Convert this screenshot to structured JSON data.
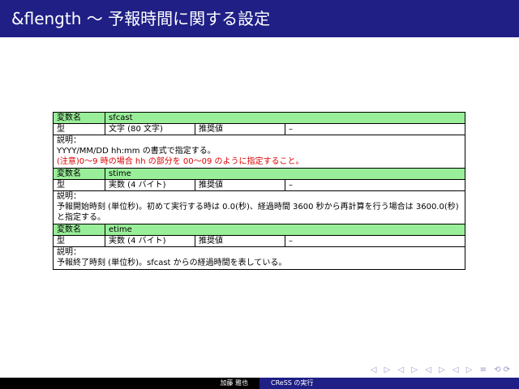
{
  "slide": {
    "title": "&flength 〜 予報時間に関する設定"
  },
  "labels": {
    "var_name": "変数名",
    "type": "型",
    "recommended": "推奨値",
    "description": "説明："
  },
  "variables": [
    {
      "name": "sfcast",
      "type": "文字 (80 文字)",
      "recommended": "–",
      "desc_line1": "YYYY/MM/DD hh:mm の書式で指定する。",
      "desc_line2": "(注意)0〜9 時の場合 hh の部分を 00〜09 のように指定すること。"
    },
    {
      "name": "stime",
      "type": "実数 (4 バイト)",
      "recommended": "–",
      "desc_line1": "予報開始時刻 (単位秒)。初めて実行する時は 0.0(秒)、経過時間 3600 秒から再計算を行う場合は 3600.0(秒) と指定する。"
    },
    {
      "name": "etime",
      "type": "実数 (4 バイト)",
      "recommended": "–",
      "desc_line1": "予報終了時刻 (単位秒)。sfcast からの経過時間を表している。"
    }
  ],
  "navigation": {
    "symbols": "◁ ▷ ◁ ▷ ◁ ▷ ◁ ▷ ≡ ⟲⟳"
  },
  "footer": {
    "author": "加藤 雅也",
    "title": "CReSS の実行"
  },
  "colors": {
    "title_bar": "#1f1f86",
    "header_row": "#99ee99",
    "note_text": "#dd0000"
  }
}
